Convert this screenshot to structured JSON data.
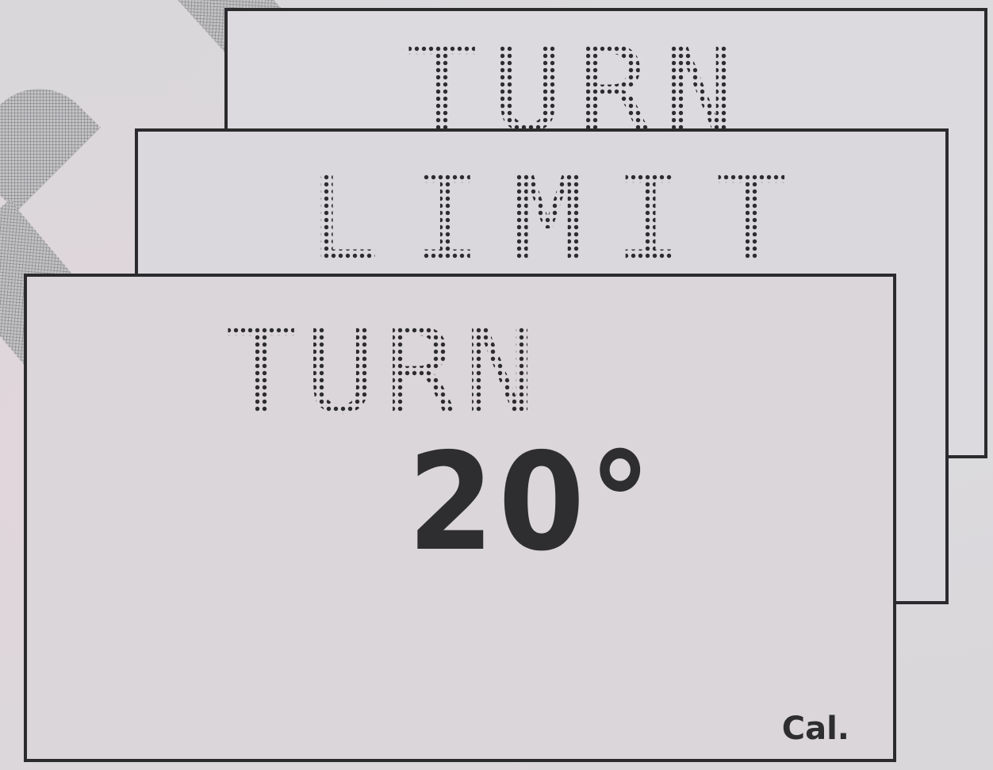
{
  "screens": {
    "back": {
      "title": "TURN"
    },
    "middle": {
      "title": "LIMIT"
    },
    "front": {
      "title": "TURN",
      "value": "20°",
      "softkey": "Cal."
    }
  },
  "colors": {
    "lcd_background": "#dbd6da",
    "segment_ink": "#2c2c2e",
    "frame": "#2b2b2d"
  }
}
